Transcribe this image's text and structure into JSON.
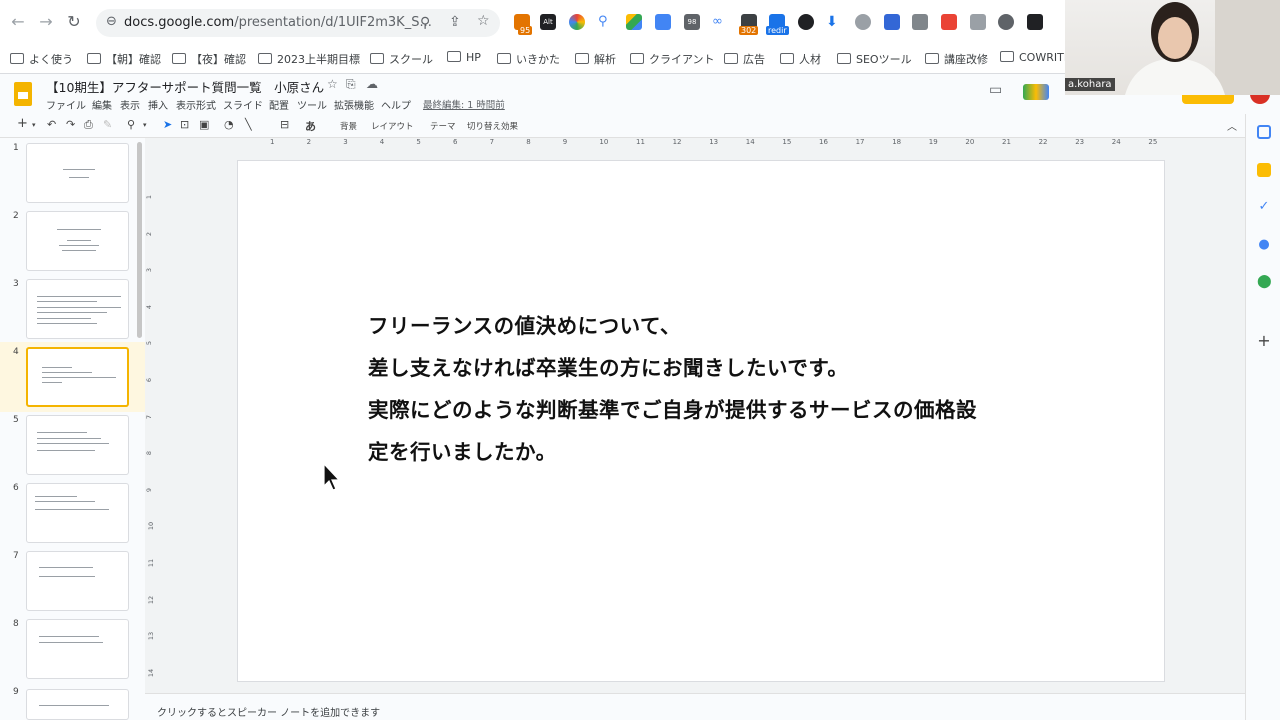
{
  "browser": {
    "url_main": "docs.google.com",
    "url_path": "/presentation/d/1UIF2m3K_S...",
    "extension_badges": [
      "95",
      "Alt",
      "98",
      "302",
      "redir"
    ]
  },
  "bookmarks": [
    "よく使う",
    "【朝】確認",
    "【夜】確認",
    "2023上半期目標",
    "スクール",
    "HP",
    "いきかた",
    "解析",
    "クライアント",
    "広告",
    "人材",
    "SEOツール",
    "講座改修",
    "COWRITI"
  ],
  "doc": {
    "title": "【10期生】アフターサポート質問一覧　小原さん",
    "last_edit": "最終編集: 1 時間前"
  },
  "menu": [
    "ファイル",
    "編集",
    "表示",
    "挿入",
    "表示形式",
    "スライド",
    "配置",
    "ツール",
    "拡張機能",
    "ヘルプ"
  ],
  "toolbar": {
    "input_tool": "あ",
    "background": "背景",
    "layout": "レイアウト",
    "theme": "テーマ",
    "transition": "切り替え効果"
  },
  "filmstrip": {
    "slide_numbers": [
      "1",
      "2",
      "3",
      "4",
      "5",
      "6",
      "7",
      "8",
      "9"
    ],
    "selected": 4
  },
  "ruler": {
    "top": [
      "1",
      "2",
      "3",
      "4",
      "5",
      "6",
      "7",
      "8",
      "9",
      "10",
      "11",
      "12",
      "13",
      "14",
      "15",
      "16",
      "17",
      "18",
      "19",
      "20",
      "21",
      "22",
      "23",
      "24",
      "25"
    ],
    "left": [
      "1",
      "2",
      "3",
      "4",
      "5",
      "6",
      "7",
      "8",
      "9",
      "10",
      "11",
      "12",
      "13",
      "14"
    ]
  },
  "slide": {
    "lines": [
      "フリーランスの値決めについて、",
      "差し支えなければ卒業生の方にお聞きしたいです。",
      "実際にどのような判断基準でご自身が提供するサービスの価格設",
      "定を行いましたか。"
    ]
  },
  "notes": {
    "placeholder": "クリックするとスピーカー ノートを追加できます"
  },
  "webcam": {
    "name": "a.kohara"
  },
  "colors": {
    "slides_yellow": "#f4b400",
    "selection_bg": "#fef7e0"
  }
}
